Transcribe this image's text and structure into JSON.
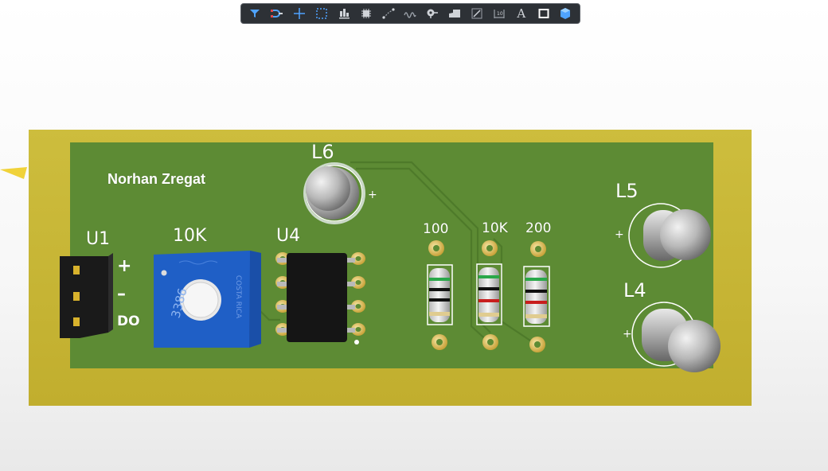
{
  "toolbar": {
    "buttons": [
      {
        "name": "filter-icon"
      },
      {
        "name": "snap-magnet-icon"
      },
      {
        "name": "crosshair-icon"
      },
      {
        "name": "select-area-icon"
      },
      {
        "name": "align-bottom-icon"
      },
      {
        "name": "component-icon"
      },
      {
        "name": "route-net-icon"
      },
      {
        "name": "interactive-length-icon"
      },
      {
        "name": "pad-icon"
      },
      {
        "name": "region-icon"
      },
      {
        "name": "line-icon"
      },
      {
        "name": "dimension-icon"
      },
      {
        "name": "text-icon"
      },
      {
        "name": "rectangle-icon"
      },
      {
        "name": "3d-body-icon"
      }
    ],
    "text_button_glyph": "A"
  },
  "board": {
    "author_label": "Norhan Zregat",
    "designators": {
      "u1": "U1",
      "pot": "10K",
      "u4": "U4",
      "l6": "L6",
      "l5": "L5",
      "l4": "L4",
      "r_100": "100",
      "r_10k": "10K",
      "r_200": "200"
    },
    "header_pins": {
      "plus": "+",
      "minus": "–",
      "out": "DO"
    },
    "polarity_mark": "+",
    "trimpot_text": {
      "part": "3386",
      "brand": "COSTA RICA"
    },
    "colors": {
      "board": "#c9ba36",
      "soldermask": "#5d8b34",
      "trimpot": "#1f5fc6",
      "ic": "#151515"
    }
  }
}
